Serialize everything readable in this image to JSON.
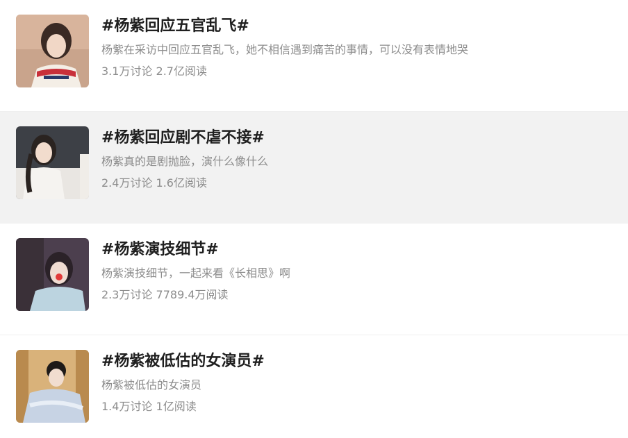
{
  "topics": [
    {
      "title": "#杨紫回应五官乱飞#",
      "desc": "杨紫在采访中回应五官乱飞，她不相信遇到痛苦的事情，可以没有表情地哭",
      "stats": "3.1万讨论 2.7亿阅读"
    },
    {
      "title": "#杨紫回应剧不虐不接#",
      "desc": "杨紫真的是剧抛脸，演什么像什么",
      "stats": "2.4万讨论 1.6亿阅读"
    },
    {
      "title": "#杨紫演技细节#",
      "desc": "杨紫演技细节，一起来看《长相思》啊",
      "stats": "2.3万讨论 7789.4万阅读"
    },
    {
      "title": "#杨紫被低估的女演员#",
      "desc": "杨紫被低估的女演员",
      "stats": "1.4万讨论 1亿阅读"
    }
  ],
  "colors": {
    "title": "#1f1f1f",
    "secondary": "#8c8c8c",
    "highlight_row": "#f2f2f2"
  }
}
